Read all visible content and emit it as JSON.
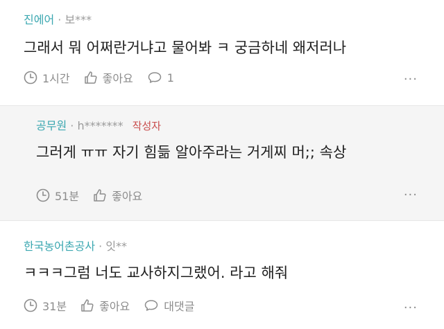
{
  "comments": [
    {
      "company": "진에어",
      "separator": "·",
      "nickname": "보***",
      "author_badge": "",
      "text": "그래서 뭐 어쩌란거냐고 물어봐 ㅋ 궁금하네 왜저러나",
      "time": "1시간",
      "like_label": "좋아요",
      "reply_label": "1",
      "more": "···"
    },
    {
      "company": "공무원",
      "separator": "·",
      "nickname": "h*******",
      "author_badge": "작성자",
      "text": "그러게 ㅠㅠ 자기 힘듦 알아주라는 거게찌 머;; 속상",
      "time": "51분",
      "like_label": "좋아요",
      "more": "···"
    },
    {
      "company": "한국농어촌공사",
      "separator": "·",
      "nickname": "잇**",
      "author_badge": "",
      "text": "ㅋㅋㅋ그럼 너도 교사하지그랬어. 라고 해줘",
      "time": "31분",
      "like_label": "좋아요",
      "reply_label": "대댓글",
      "more": "···"
    }
  ],
  "colors": {
    "company": "#3aa7b0",
    "author_badge": "#c84c4c",
    "meta_gray": "#9a9a9a",
    "reply_background": "#f5f5f5"
  },
  "icons": [
    "clock-icon",
    "thumbs-up-icon",
    "speech-bubble-icon",
    "more-dots-icon"
  ]
}
